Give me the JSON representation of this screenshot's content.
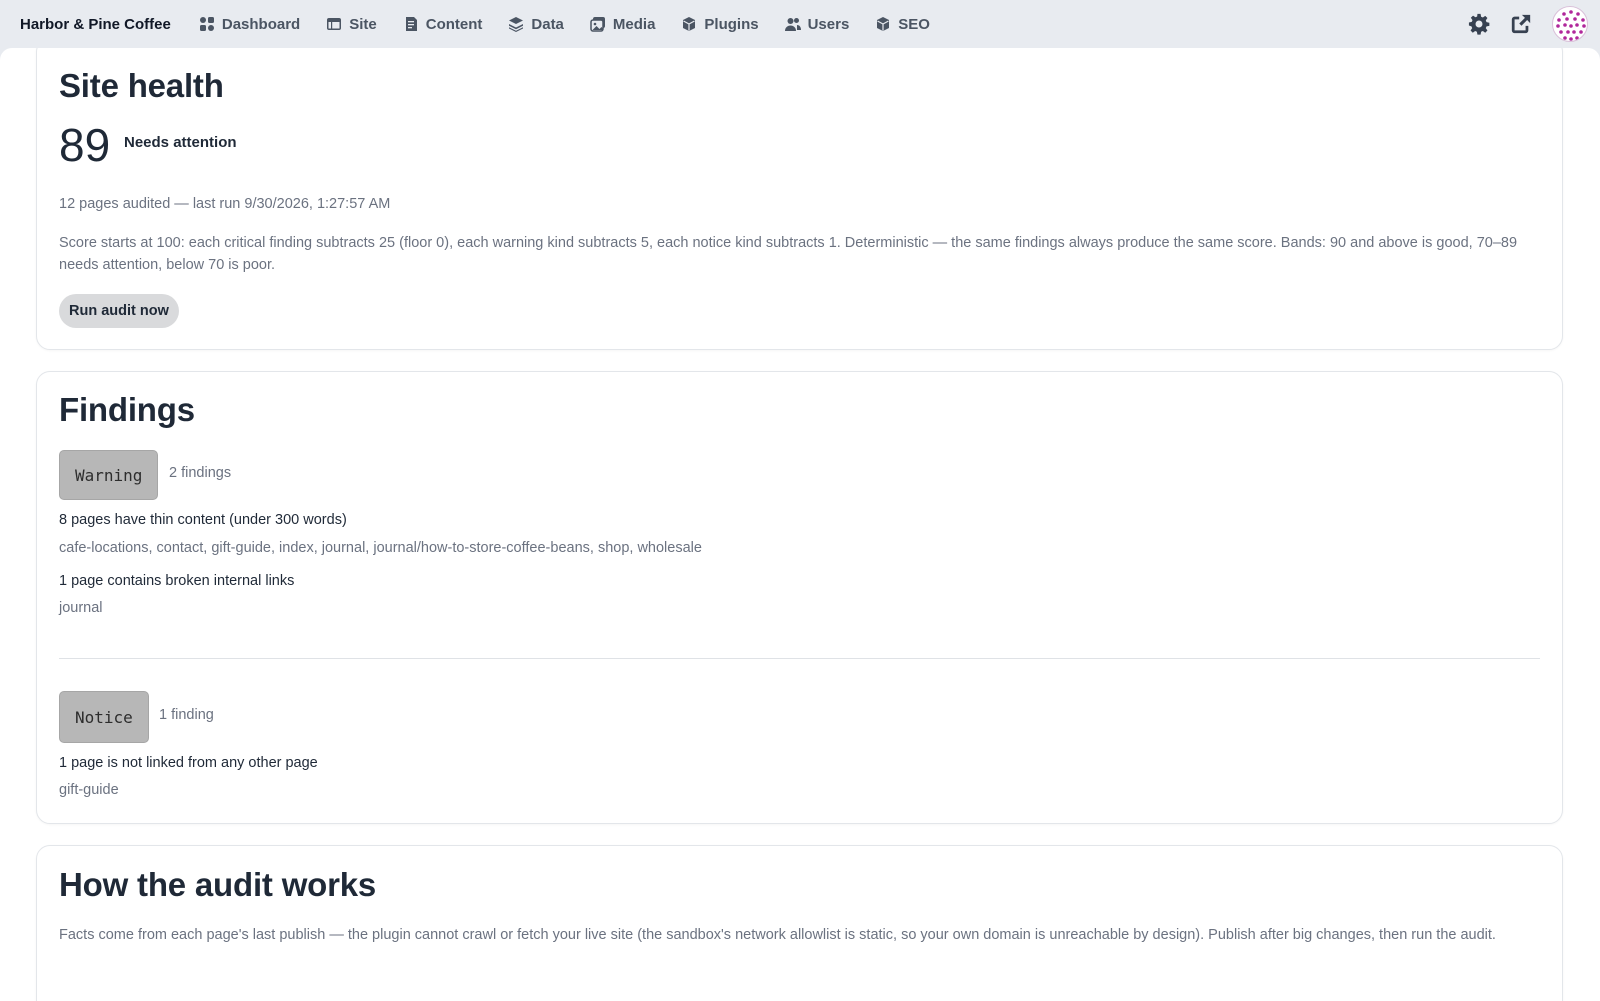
{
  "brand": "Harbor & Pine Coffee",
  "nav": [
    {
      "label": "Dashboard",
      "icon": "dashboard-icon"
    },
    {
      "label": "Site",
      "icon": "site-icon"
    },
    {
      "label": "Content",
      "icon": "content-icon"
    },
    {
      "label": "Data",
      "icon": "data-icon"
    },
    {
      "label": "Media",
      "icon": "media-icon"
    },
    {
      "label": "Plugins",
      "icon": "plugins-icon"
    },
    {
      "label": "Users",
      "icon": "users-icon"
    },
    {
      "label": "SEO",
      "icon": "seo-icon"
    }
  ],
  "top_right": {
    "settings_icon": "gear-icon",
    "open_site_icon": "external-link-icon",
    "avatar_color": "#b0279b"
  },
  "health": {
    "title": "Site health",
    "score": "89",
    "band": "Needs attention",
    "audited": "12 pages audited — last run 9/30/2026, 1:27:57 AM",
    "explanation": "Score starts at 100: each critical finding subtracts 25 (floor 0), each warning kind subtracts 5, each notice kind subtracts 1. Deterministic — the same findings always produce the same score. Bands: 90 and above is good, 70–89 needs attention, below 70 is poor.",
    "run_button": "Run audit now"
  },
  "findings": {
    "title": "Findings",
    "groups": [
      {
        "severity": "Warning",
        "count": "2 findings",
        "items": [
          {
            "title": "8 pages have thin content (under 300 words)",
            "pages": "cafe-locations, contact, gift-guide, index, journal, journal/how-to-store-coffee-beans, shop, wholesale"
          },
          {
            "title": "1 page contains broken internal links",
            "pages": "journal"
          }
        ]
      },
      {
        "severity": "Notice",
        "count": "1 finding",
        "items": [
          {
            "title": "1 page is not linked from any other page",
            "pages": "gift-guide"
          }
        ]
      }
    ]
  },
  "how": {
    "title": "How the audit works",
    "text": "Facts come from each page's last publish — the plugin cannot crawl or fetch your live site (the sandbox's network allowlist is static, so your own domain is unreachable by design). Publish after big changes, then run the audit."
  }
}
